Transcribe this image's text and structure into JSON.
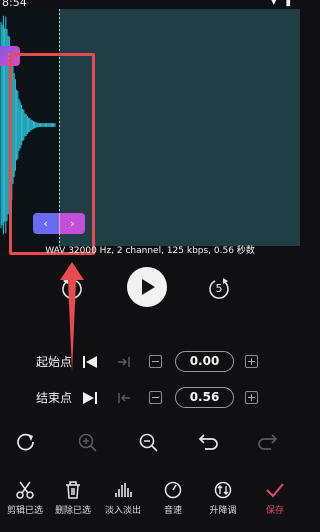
{
  "status": {
    "time": "8:54",
    "icons": "▾ ▮"
  },
  "colors": {
    "accent": "#e8457a",
    "wave": "#2ec9e0",
    "panel": "#1f3e46",
    "annotation": "#e84a4e"
  },
  "waveform": {
    "start_handle_icon": "chevron-right-icon",
    "nav_left_icon": "chevron-left-icon",
    "nav_right_icon": "chevron-right-icon",
    "info": "WAV 32000 Hz, 2 channel, 125 kbps, 0.56 秒数"
  },
  "transport": {
    "rewind_seconds": "5",
    "forward_seconds": "5"
  },
  "start_point": {
    "label": "起始点",
    "value": "0.00",
    "minus": "−",
    "plus": "+"
  },
  "end_point": {
    "label": "结束点",
    "value": "0.56",
    "minus": "−",
    "plus": "+"
  },
  "tools": [
    "redo-circle-icon",
    "zoom-in-icon",
    "zoom-out-icon",
    "undo-icon",
    "redo-icon"
  ],
  "actions": [
    {
      "label": "剪辑已选",
      "icon": "scissors-icon"
    },
    {
      "label": "删除已选",
      "icon": "trash-icon"
    },
    {
      "label": "淡入淡出",
      "icon": "fade-icon"
    },
    {
      "label": "音速",
      "icon": "speed-icon"
    },
    {
      "label": "升降调",
      "icon": "pitch-icon"
    },
    {
      "label": "保存",
      "icon": "check-icon"
    }
  ]
}
